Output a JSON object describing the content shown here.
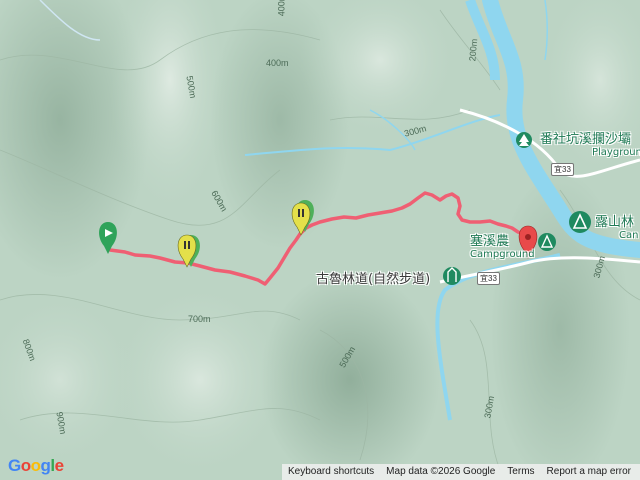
{
  "map": {
    "type": "terrain",
    "colors": {
      "track": "#ef5f73",
      "water": "#8fd6ef",
      "poi": "#1f8a60",
      "terrain": "#bcd4c4"
    }
  },
  "pois": [
    {
      "name": "番社坑溪攔沙壩",
      "sub": "Playground",
      "icon": "tree-icon"
    },
    {
      "name": "露山林",
      "sub": "Can",
      "icon": "campground-icon"
    },
    {
      "name": "塞溪農",
      "sub": "Campground",
      "icon": "campground-icon"
    },
    {
      "name": "古魯林道(自然步道)",
      "sub": "",
      "icon": "trail-icon"
    }
  ],
  "roads": [
    {
      "label": "宜33"
    },
    {
      "label": "宜33"
    }
  ],
  "contours": [
    "400m",
    "500m",
    "600m",
    "700m",
    "800m",
    "900m",
    "500m",
    "300m",
    "200m",
    "300m",
    "300m",
    "400m"
  ],
  "markers": [
    {
      "kind": "start",
      "icon": "flag-icon"
    },
    {
      "kind": "waypoint",
      "icon": "pause-marker-icon"
    },
    {
      "kind": "waypoint",
      "icon": "pause-marker-icon"
    },
    {
      "kind": "end",
      "icon": "map-pin-icon"
    }
  ],
  "attribution": {
    "logo": "Google",
    "keyboard": "Keyboard shortcuts",
    "data": "Map data ©2026 Google",
    "terms": "Terms",
    "report": "Report a map error"
  }
}
